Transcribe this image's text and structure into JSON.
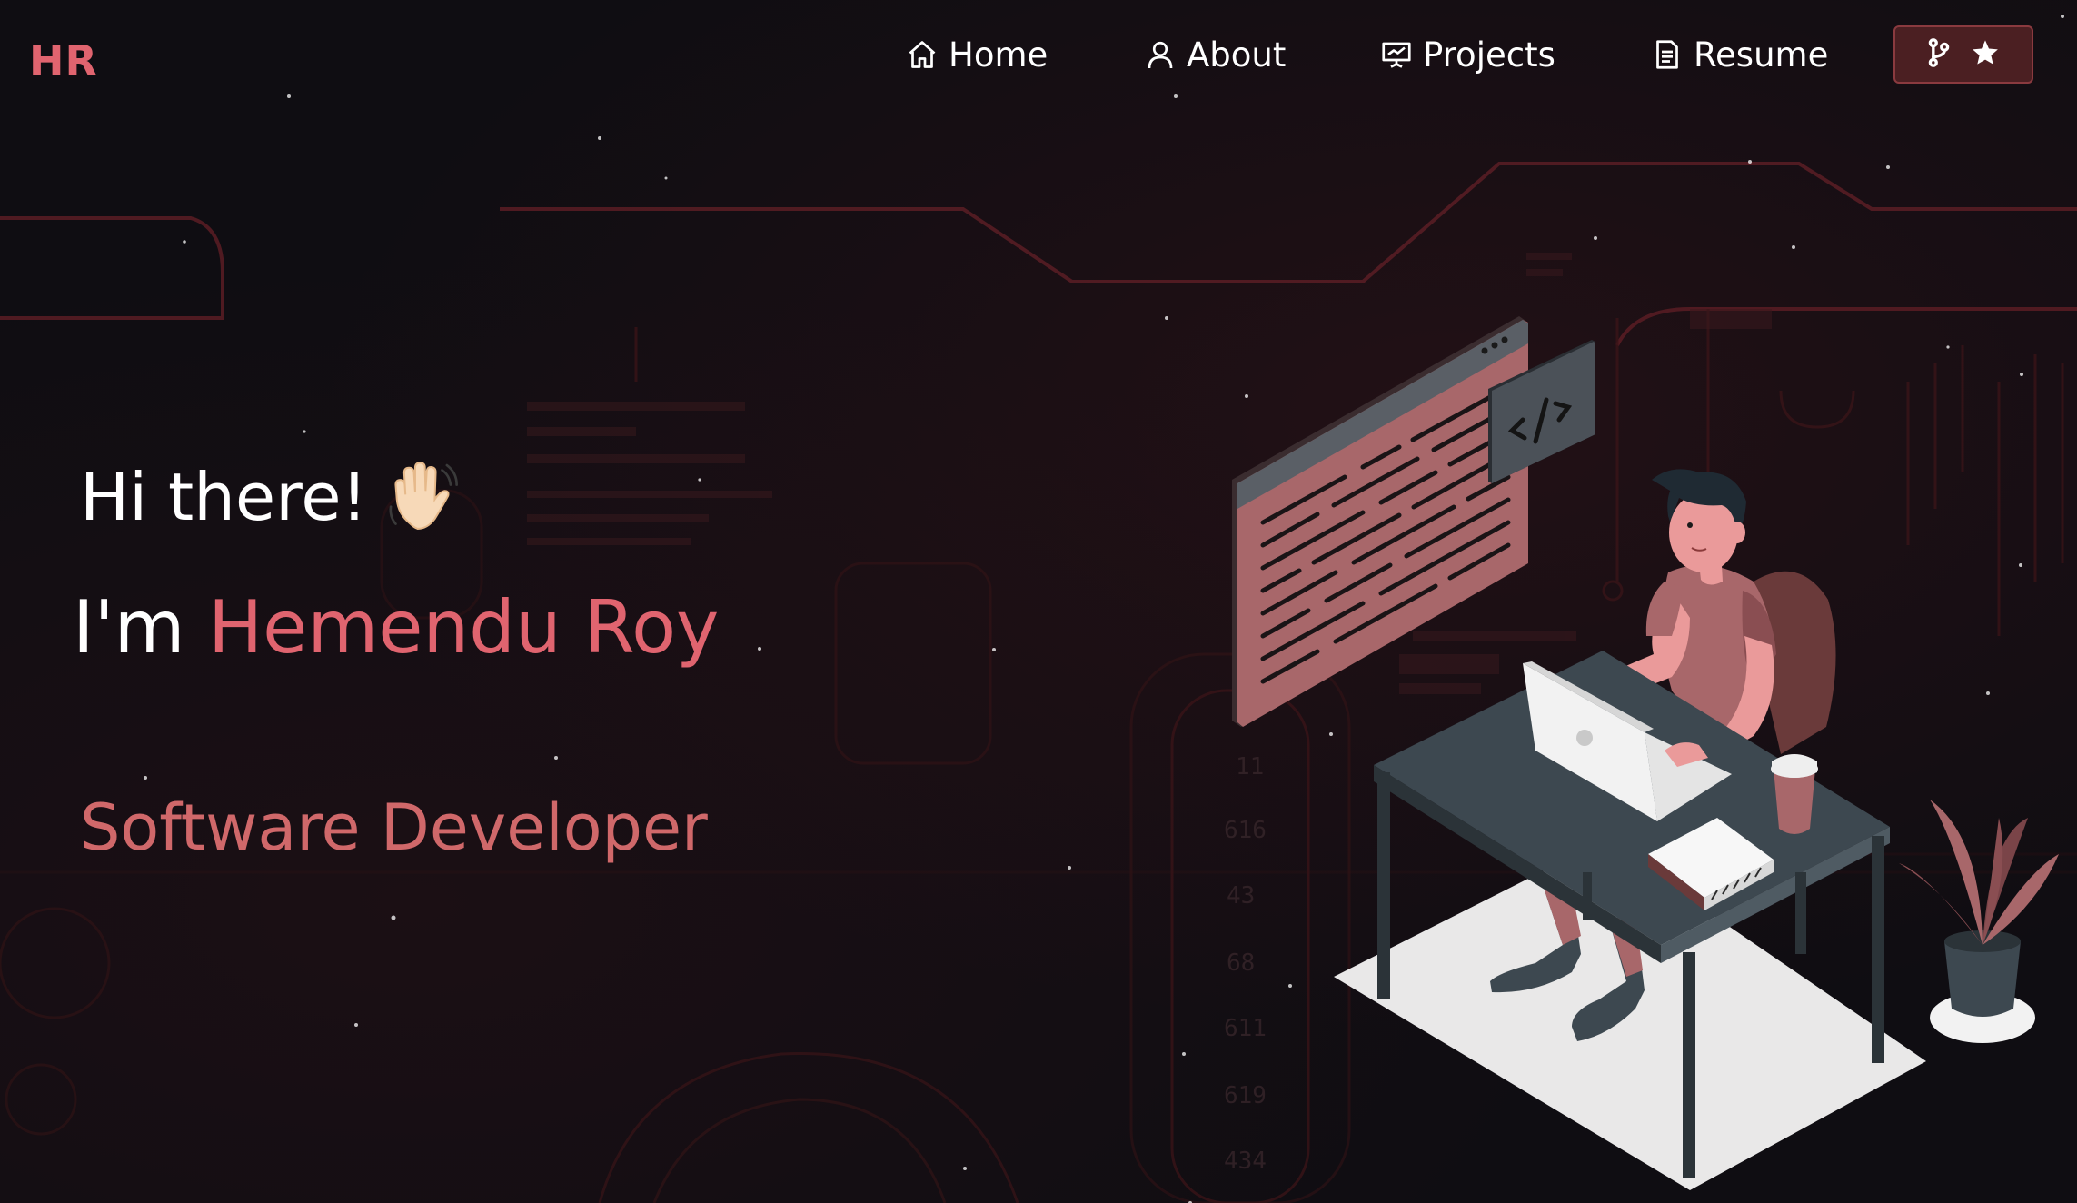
{
  "navbar": {
    "logo": "HR",
    "links": [
      {
        "label": "Home",
        "icon": "home-icon"
      },
      {
        "label": "About",
        "icon": "user-icon"
      },
      {
        "label": "Projects",
        "icon": "presentation-icon"
      },
      {
        "label": "Resume",
        "icon": "document-icon"
      }
    ],
    "github_button": {
      "icons": [
        "fork-icon",
        "star-icon"
      ]
    }
  },
  "hero": {
    "greeting": "Hi there!",
    "greeting_emoji": "waving-hand-icon",
    "intro_prefix": "I'm ",
    "name": "Hemendu Roy",
    "role": "Software Developer"
  },
  "illustration": {
    "code_symbol": "</>"
  },
  "colors": {
    "accent": "#e0646f",
    "role_text": "#d0686a",
    "background": "#0f0d12",
    "button_bg": "#4b1f22"
  }
}
